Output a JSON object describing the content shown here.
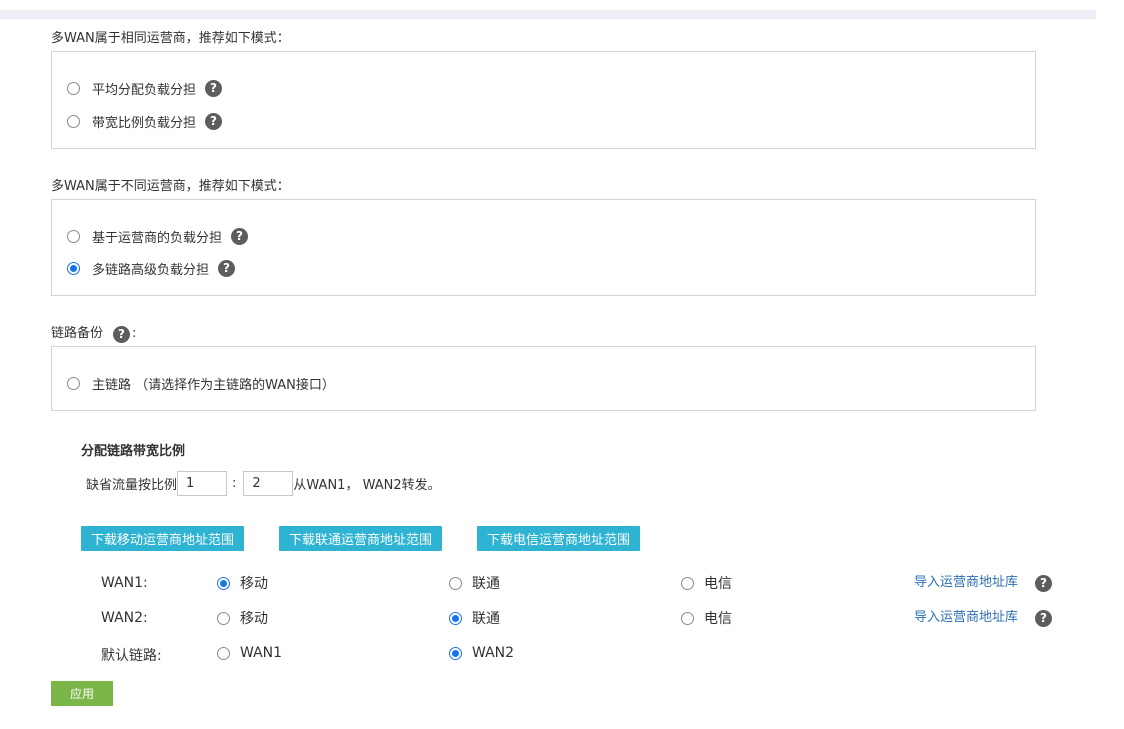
{
  "same_isp": {
    "title": "多WAN属于相同运营商，推荐如下模式：",
    "options": [
      {
        "label": "平均分配负载分担",
        "checked": false
      },
      {
        "label": "带宽比例负载分担",
        "checked": false
      }
    ]
  },
  "diff_isp": {
    "title": "多WAN属于不同运营商，推荐如下模式：",
    "options": [
      {
        "label": "基于运营商的负载分担",
        "checked": false
      },
      {
        "label": "多链路高级负载分担",
        "checked": true
      }
    ]
  },
  "backup": {
    "title": "链路备份",
    "colon": ":",
    "option": {
      "label": "主链路 （请选择作为主链路的WAN接口）",
      "checked": false
    }
  },
  "bandwidth": {
    "heading": "分配链路带宽比例",
    "prefix": "缺省流量按比例",
    "sep": ":",
    "value1": "1",
    "value2": "2",
    "suffix": "从WAN1， WAN2转发。"
  },
  "download_buttons": [
    "下载移动运营商地址范围",
    "下载联通运营商地址范围",
    "下载电信运营商地址范围"
  ],
  "isp_grid": {
    "rows": [
      {
        "label": "WAN1:",
        "options": [
          "移动",
          "联通",
          "电信"
        ],
        "selected": 0,
        "link": "导入运营商地址库"
      },
      {
        "label": "WAN2:",
        "options": [
          "移动",
          "联通",
          "电信"
        ],
        "selected": 1,
        "link": "导入运营商地址库"
      }
    ],
    "default_link": {
      "label": "默认链路:",
      "options": [
        "WAN1",
        "WAN2"
      ],
      "selected": 1
    }
  },
  "help_glyph": "?",
  "icons": {
    "help": "question-circle-icon"
  },
  "colors": {
    "accent": "#1a73e8",
    "button": "#2eb3d3",
    "apply": "#7ab648",
    "link": "#2b6fb4"
  },
  "apply_label": "应用"
}
